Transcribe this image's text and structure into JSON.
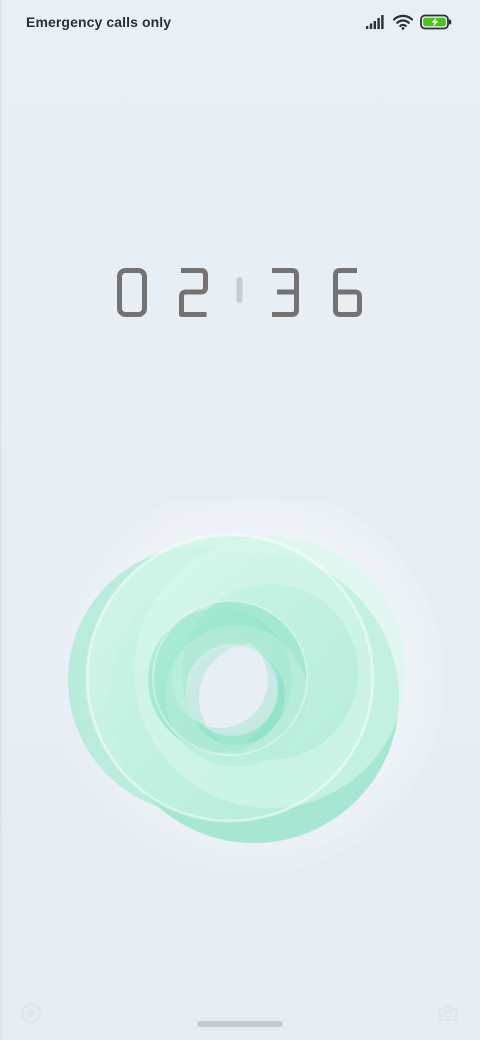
{
  "status_bar": {
    "carrier_text": "Emergency calls only",
    "signal_icon": "signal-bars-icon",
    "wifi_icon": "wifi-icon",
    "battery_icon": "battery-charging-icon",
    "battery_color": "#4cc21a"
  },
  "clock": {
    "hour_tens": "0",
    "hour_ones": "2",
    "minute_tens": "3",
    "minute_ones": "6",
    "digit_color": "#737373",
    "separator_color": "#c9cccf"
  },
  "artwork": {
    "name": "glowing-rings-artwork",
    "accent": "#8fe3c8"
  },
  "bottom": {
    "left_icon": "circle-button-icon",
    "right_icon": "camera-icon",
    "home_indicator": "home-indicator"
  }
}
